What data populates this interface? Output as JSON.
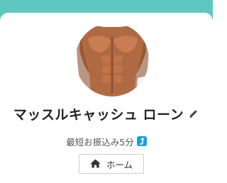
{
  "profile": {
    "name": "マッスルキャッシュ ローン",
    "subtitle": "最短お振込み5分",
    "avatar_icon": "muscular-torso-avatar",
    "edit_icon": "pencil-icon",
    "badge_icon": "bank-transfer-icon"
  },
  "nav": {
    "home_label": "ホーム",
    "home_icon": "home-icon"
  },
  "colors": {
    "banner": "#5ec8c0",
    "badge": "#1c9ed7",
    "text": "#222222"
  }
}
